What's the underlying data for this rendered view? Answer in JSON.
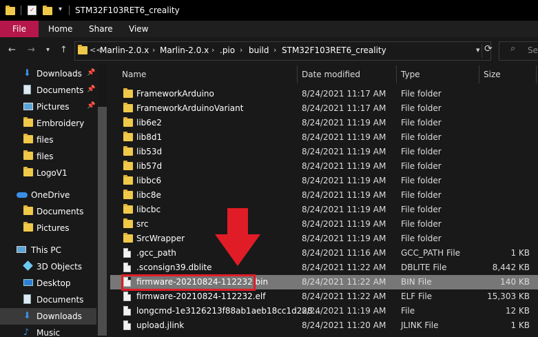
{
  "window": {
    "title": "STM32F103RET6_creality"
  },
  "ribbon": {
    "tabs": [
      "File",
      "Home",
      "Share",
      "View"
    ]
  },
  "address": {
    "crumbs": [
      "Marlin-2.0.x",
      "Marlin-2.0.x",
      ".pio",
      "build",
      "STM32F103RET6_creality"
    ],
    "overflow": "<<"
  },
  "search": {
    "placeholder": "Se"
  },
  "nav": {
    "items": [
      {
        "label": "Downloads",
        "icon": "download-arrow-icon",
        "pinned": true
      },
      {
        "label": "Documents",
        "icon": "documents-icon",
        "pinned": true
      },
      {
        "label": "Pictures",
        "icon": "pictures-icon",
        "pinned": true
      },
      {
        "label": "Embroidery",
        "icon": "folder-icon"
      },
      {
        "label": "files",
        "icon": "folder-icon"
      },
      {
        "label": "files",
        "icon": "folder-icon"
      },
      {
        "label": "LogoV1",
        "icon": "folder-icon"
      },
      {
        "label": "OneDrive",
        "icon": "onedrive-cloud-icon"
      },
      {
        "label": "Documents",
        "icon": "folder-icon"
      },
      {
        "label": "Pictures",
        "icon": "folder-icon"
      },
      {
        "label": "This PC",
        "icon": "this-pc-icon"
      },
      {
        "label": "3D Objects",
        "icon": "3d-objects-icon"
      },
      {
        "label": "Desktop",
        "icon": "desktop-icon"
      },
      {
        "label": "Documents",
        "icon": "documents-icon"
      },
      {
        "label": "Downloads",
        "icon": "download-arrow-icon"
      },
      {
        "label": "Music",
        "icon": "music-icon"
      }
    ]
  },
  "columns": {
    "name": "Name",
    "date": "Date modified",
    "type": "Type",
    "size": "Size"
  },
  "files": [
    {
      "name": "FrameworkArduino",
      "date": "8/24/2021 11:17 AM",
      "type": "File folder",
      "size": "",
      "kind": "folder"
    },
    {
      "name": "FrameworkArduinoVariant",
      "date": "8/24/2021 11:17 AM",
      "type": "File folder",
      "size": "",
      "kind": "folder"
    },
    {
      "name": "lib6e2",
      "date": "8/24/2021 11:19 AM",
      "type": "File folder",
      "size": "",
      "kind": "folder"
    },
    {
      "name": "lib8d1",
      "date": "8/24/2021 11:19 AM",
      "type": "File folder",
      "size": "",
      "kind": "folder"
    },
    {
      "name": "lib53d",
      "date": "8/24/2021 11:19 AM",
      "type": "File folder",
      "size": "",
      "kind": "folder"
    },
    {
      "name": "lib57d",
      "date": "8/24/2021 11:19 AM",
      "type": "File folder",
      "size": "",
      "kind": "folder"
    },
    {
      "name": "libbc6",
      "date": "8/24/2021 11:19 AM",
      "type": "File folder",
      "size": "",
      "kind": "folder"
    },
    {
      "name": "libc8e",
      "date": "8/24/2021 11:19 AM",
      "type": "File folder",
      "size": "",
      "kind": "folder"
    },
    {
      "name": "libcbc",
      "date": "8/24/2021 11:19 AM",
      "type": "File folder",
      "size": "",
      "kind": "folder"
    },
    {
      "name": "src",
      "date": "8/24/2021 11:19 AM",
      "type": "File folder",
      "size": "",
      "kind": "folder"
    },
    {
      "name": "SrcWrapper",
      "date": "8/24/2021 11:19 AM",
      "type": "File folder",
      "size": "",
      "kind": "folder"
    },
    {
      "name": ".gcc_path",
      "date": "8/24/2021 11:16 AM",
      "type": "GCC_PATH File",
      "size": "1 KB",
      "kind": "file"
    },
    {
      "name": ".sconsign39.dblite",
      "date": "8/24/2021 11:22 AM",
      "type": "DBLITE File",
      "size": "8,442 KB",
      "kind": "file"
    },
    {
      "name": "firmware-20210824-112232.bin",
      "date": "8/24/2021 11:22 AM",
      "type": "BIN File",
      "size": "140 KB",
      "kind": "file"
    },
    {
      "name": "firmware-20210824-112232.elf",
      "date": "8/24/2021 11:22 AM",
      "type": "ELF File",
      "size": "15,303 KB",
      "kind": "file"
    },
    {
      "name": "longcmd-1e3126213f88ab1aeb18cc1d228...",
      "date": "8/24/2021 11:19 AM",
      "type": "File",
      "size": "12 KB",
      "kind": "file"
    },
    {
      "name": "upload.jlink",
      "date": "8/24/2021 11:20 AM",
      "type": "JLINK File",
      "size": "1 KB",
      "kind": "file"
    }
  ],
  "highlighted_file_index": 13,
  "colors": {
    "accent_file_tab": "#b5174a",
    "annotation_red": "#e01d26",
    "folder_yellow": "#f0c94a"
  }
}
